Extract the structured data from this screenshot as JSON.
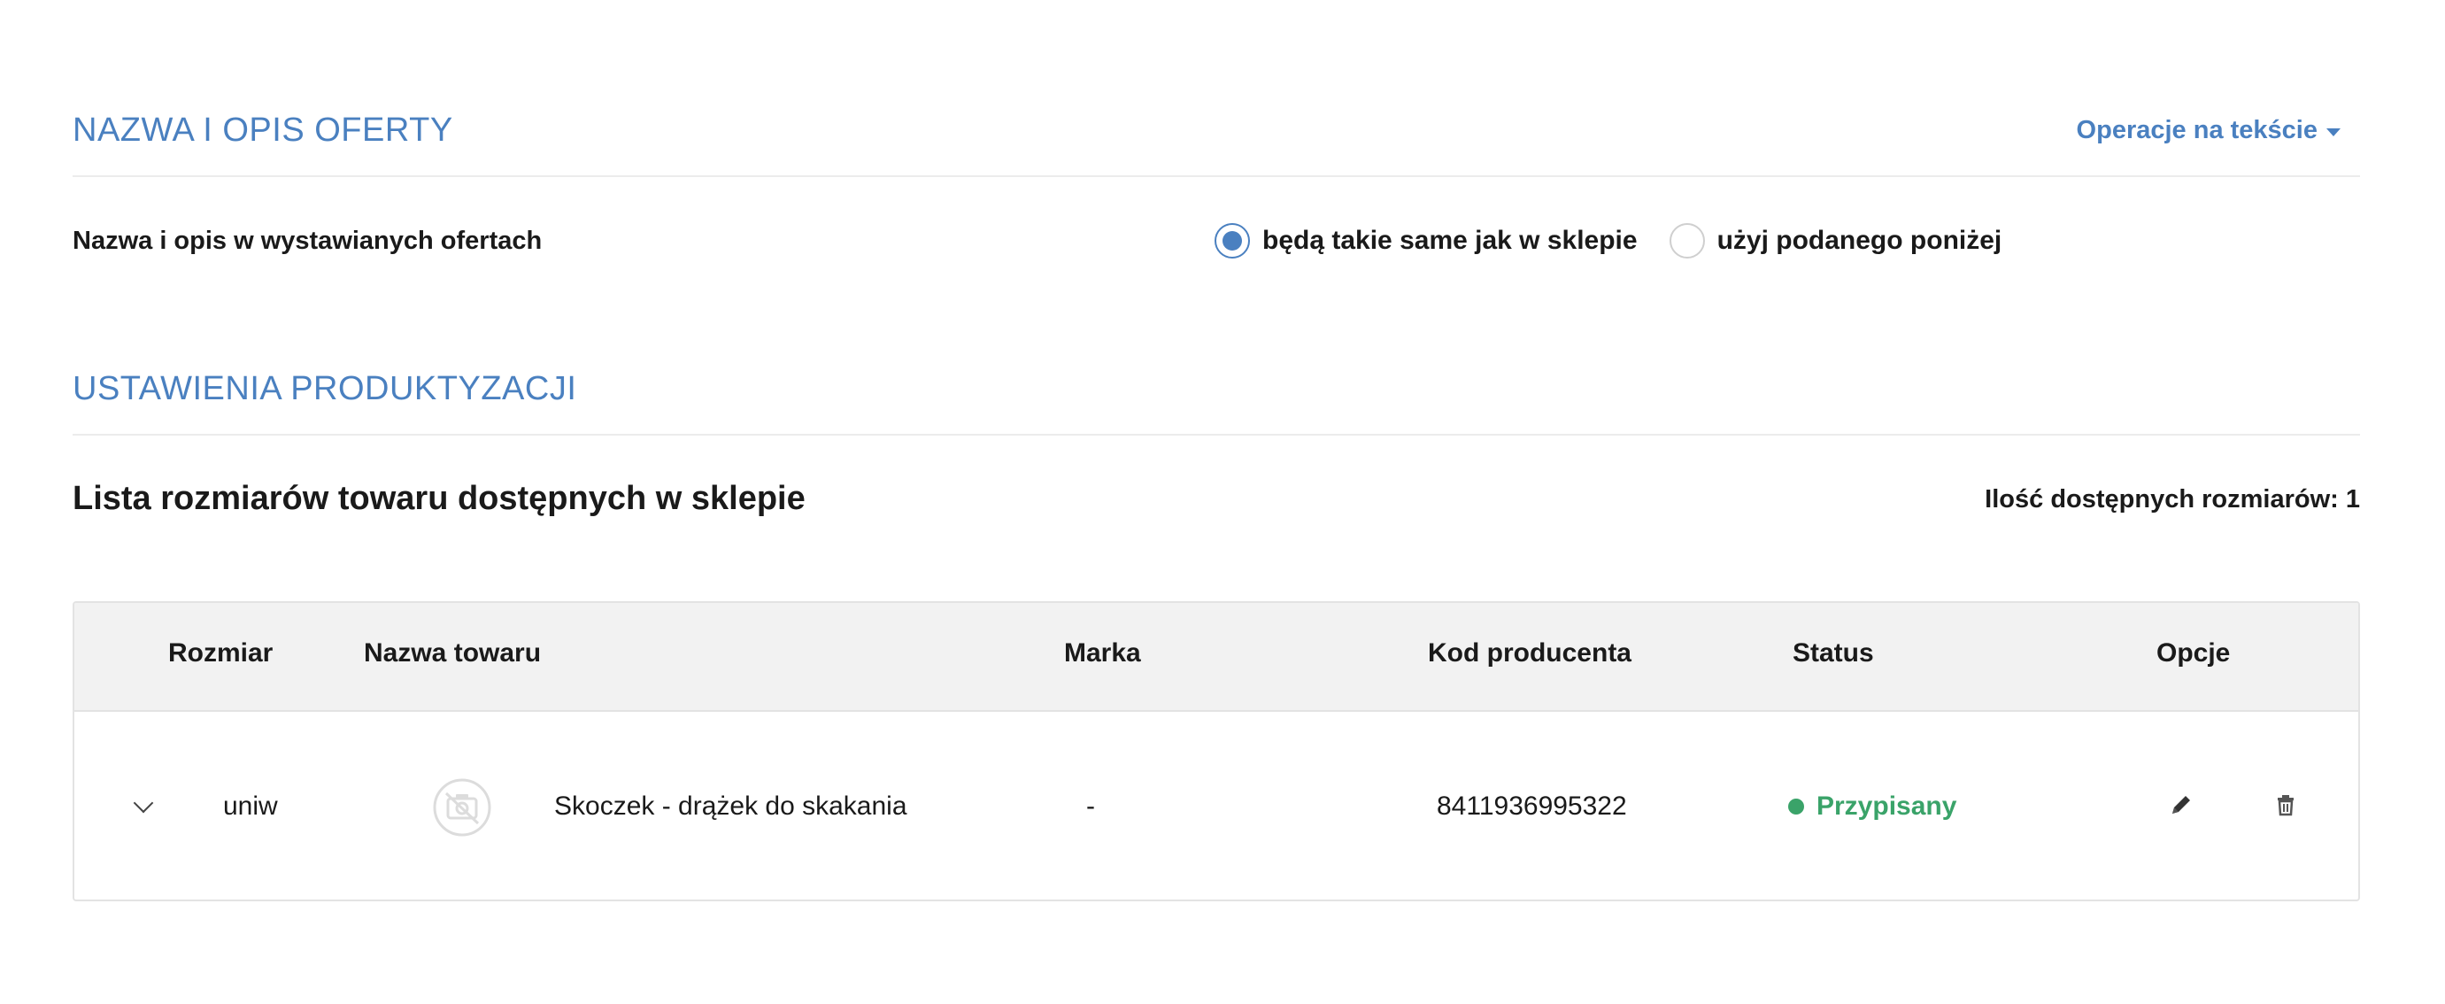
{
  "offer_section": {
    "title": "NAZWA I OPIS OFERTY",
    "text_operations_label": "Operacje na tekście",
    "name_desc_label": "Nazwa i opis w wystawianych ofertach",
    "radio_options": [
      {
        "label": "będą takie same jak w sklepie",
        "selected": true
      },
      {
        "label": "użyj podanego poniżej",
        "selected": false
      }
    ]
  },
  "productization_section": {
    "title": "USTAWIENIA PRODUKTYZACJI",
    "list_title": "Lista rozmiarów towaru dostępnych w sklepie",
    "available_sizes": "Ilość dostępnych rozmiarów: 1"
  },
  "table": {
    "headers": [
      "Rozmiar",
      "Nazwa towaru",
      "Marka",
      "Kod producenta",
      "Status",
      "Opcje"
    ],
    "rows": [
      {
        "size": "uniw",
        "product_name": "Skoczek - drążek do skakania",
        "brand": "-",
        "producer_code": "8411936995322",
        "status": "Przypisany"
      }
    ]
  },
  "icons": {
    "expand": "chevron-down-icon",
    "image": "no-photo-icon",
    "edit": "pencil-icon",
    "delete": "trash-icon"
  },
  "colors": {
    "accent": "#4a80c0",
    "status_ok": "#3aa369"
  }
}
